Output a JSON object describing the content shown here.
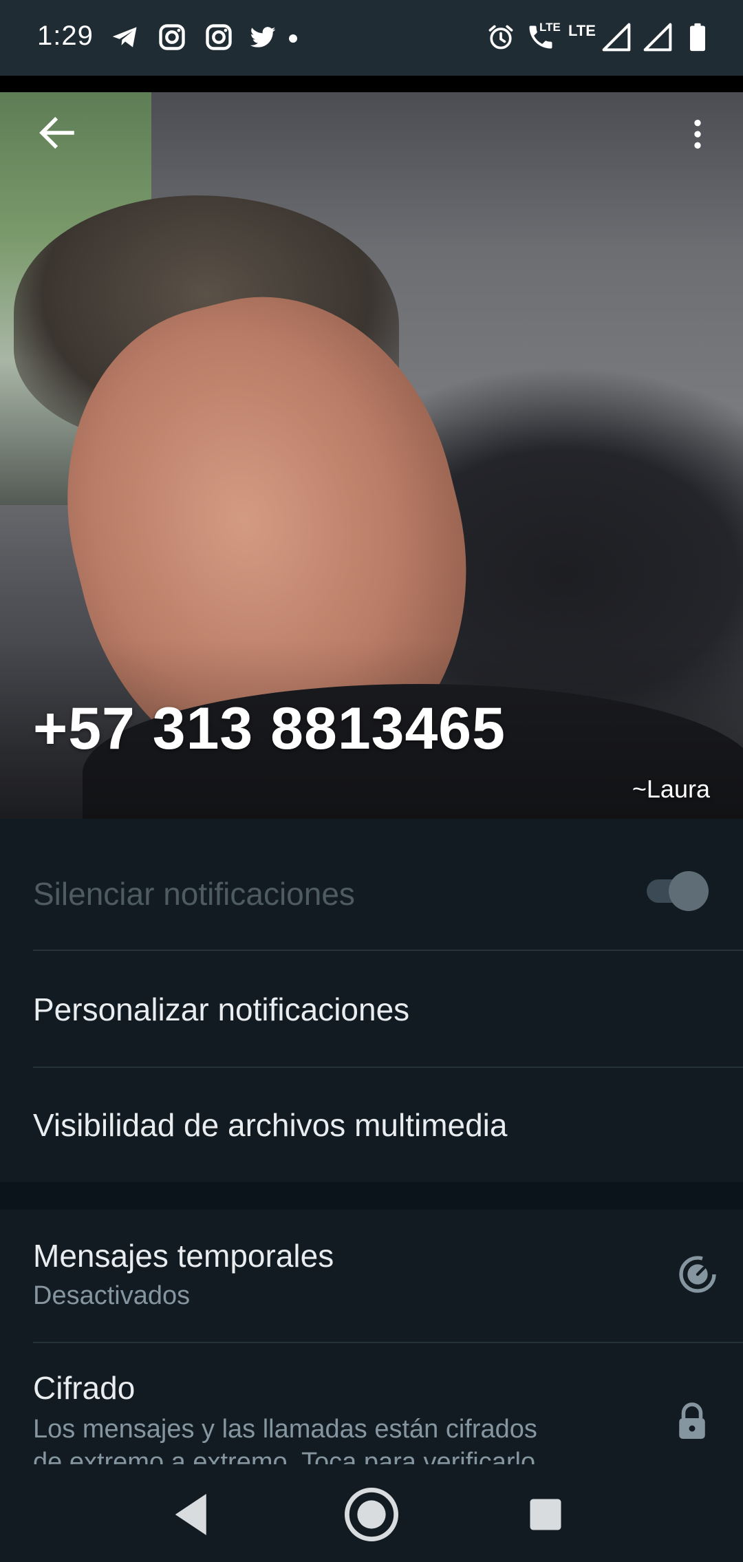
{
  "status_bar": {
    "time": "1:29",
    "left_icons": [
      "telegram-icon",
      "instagram-icon",
      "instagram-icon",
      "twitter-icon",
      "notification-dot"
    ],
    "right_icons": [
      "alarm-icon",
      "volte-call-icon",
      "lte-icon",
      "signal-icon",
      "signal-icon",
      "battery-icon"
    ],
    "volte_label": "LTE",
    "lte_label": "LTE"
  },
  "header": {
    "back_icon": "arrow-back-icon",
    "menu_icon": "more-vert-icon",
    "phone": "+57 313 8813465",
    "push_name": "~Laura"
  },
  "settings": {
    "mute": {
      "title": "Silenciar notificaciones",
      "enabled": false
    },
    "custom_notifications": {
      "title": "Personalizar notificaciones"
    },
    "media_visibility": {
      "title": "Visibilidad de archivos multimedia"
    },
    "disappearing": {
      "title": "Mensajes temporales",
      "subtitle": "Desactivados",
      "icon": "timer-icon"
    },
    "encryption": {
      "title": "Cifrado",
      "subtitle_line1": "Los mensajes y las llamadas están cifrados",
      "subtitle_line2": "de extremo a extremo. Toca para verificarlo.",
      "icon": "lock-icon"
    }
  },
  "nav_bar": {
    "back": "nav-back-icon",
    "home": "nav-home-icon",
    "recents": "nav-recents-icon"
  },
  "colors": {
    "background": "#121b22",
    "status_bar": "#1f2c34",
    "primary_text": "#e9edef",
    "secondary_text": "#8696a0",
    "divider": "#26323a",
    "disabled_text": "#4f5b63"
  }
}
